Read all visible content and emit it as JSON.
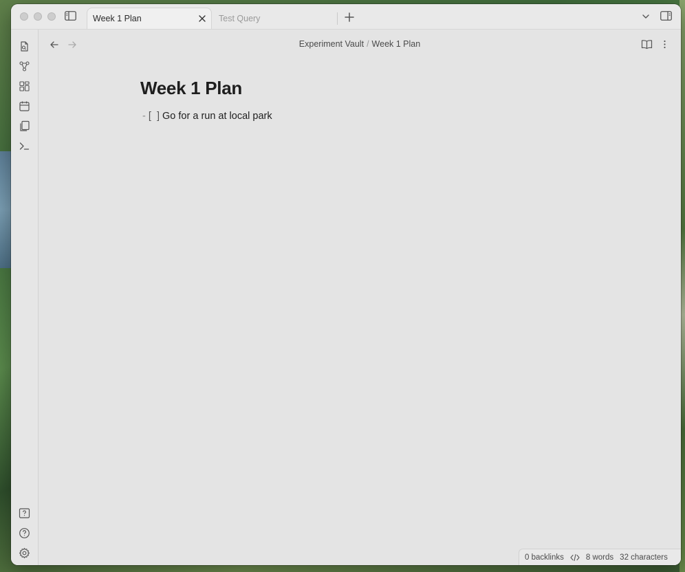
{
  "tabs": {
    "active": {
      "label": "Week 1 Plan"
    },
    "inactive": {
      "label": "Test Query"
    }
  },
  "breadcrumb": {
    "vault": "Experiment Vault",
    "separator": "/",
    "note": "Week 1 Plan"
  },
  "note": {
    "title": "Week 1 Plan",
    "task": {
      "marker": "-",
      "checkbox_open": "[",
      "checkbox_close": "]",
      "text": "Go for a run at local park"
    }
  },
  "status_bar": {
    "backlinks": "0 backlinks",
    "words": "8 words",
    "characters": "32 characters"
  },
  "ribbon_icons": [
    "quick-switcher-icon",
    "graph-view-icon",
    "canvas-icon",
    "daily-note-icon",
    "templates-icon",
    "command-palette-icon",
    "vault-switcher-icon",
    "help-icon",
    "settings-icon"
  ],
  "colors": {
    "window_bg": "#e4e4e4",
    "text": "#1e1e1e",
    "muted": "#9a9a9a"
  }
}
